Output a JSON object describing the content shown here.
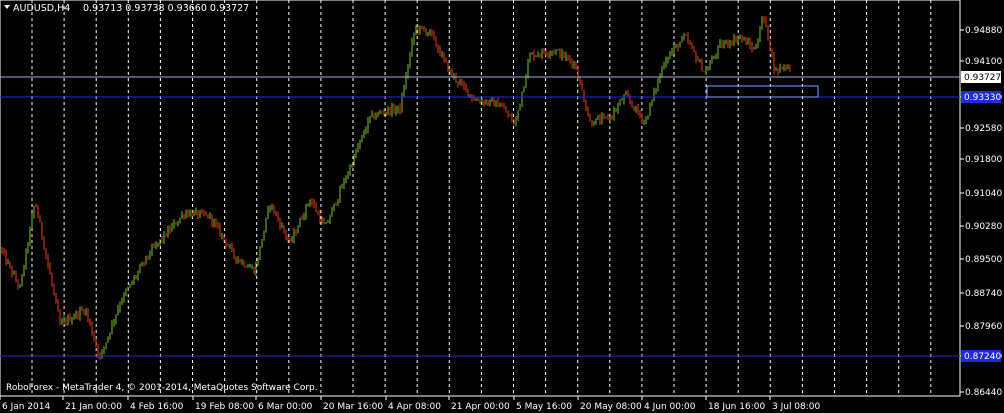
{
  "header": {
    "symbol_tf": "AUDUSD,H4",
    "ohlc": "0.93713 0.93738 0.93660 0.93727"
  },
  "copyright": "RoboForex - MetaTrader 4, © 2001-2014, MetaQuotes Software Corp.",
  "colors": {
    "background": "#000000",
    "up": "#7FBF2A",
    "down": "#E8401C",
    "grid": "#FFFFFF",
    "price_line": "#9FB2D6",
    "hline": "#1F2AE0",
    "label_text": "#FFFFFF"
  },
  "levels": {
    "current_price_label": "0.93727",
    "blue_line_upper": "0.93330",
    "blue_line_lower": "0.87240",
    "rectangle_top": "0.93727"
  },
  "chart_data": {
    "type": "candlestick",
    "title": "",
    "xlabel": "",
    "ylabel": "",
    "ylim": [
      0.8641,
      0.9522
    ],
    "grid": true,
    "y_ticks": [
      "0.94880",
      "0.94100",
      "0.93330",
      "0.92580",
      "0.91800",
      "0.91040",
      "0.90280",
      "0.89500",
      "0.88740",
      "0.87960",
      "0.87240",
      "0.86440"
    ],
    "x_ticks": [
      "6 Jan 2014",
      "21 Jan 00:00",
      "4 Feb 16:00",
      "19 Feb 08:00",
      "6 Mar 00:00",
      "20 Mar 16:00",
      "4 Apr 08:00",
      "21 Apr 00:00",
      "5 May 16:00",
      "20 May 08:00",
      "4 Jun 00:00",
      "18 Jun 16:00",
      "3 Jul 08:00"
    ],
    "path_points": [
      [
        0.0,
        0.897
      ],
      [
        0.02,
        0.888
      ],
      [
        0.035,
        0.9075
      ],
      [
        0.06,
        0.88
      ],
      [
        0.085,
        0.8835
      ],
      [
        0.1,
        0.8725
      ],
      [
        0.12,
        0.885
      ],
      [
        0.15,
        0.896
      ],
      [
        0.185,
        0.905
      ],
      [
        0.21,
        0.904
      ],
      [
        0.235,
        0.895
      ],
      [
        0.255,
        0.892
      ],
      [
        0.27,
        0.907
      ],
      [
        0.29,
        0.898
      ],
      [
        0.31,
        0.908
      ],
      [
        0.325,
        0.9015
      ],
      [
        0.35,
        0.915
      ],
      [
        0.37,
        0.926
      ],
      [
        0.385,
        0.9275
      ],
      [
        0.4,
        0.928
      ],
      [
        0.415,
        0.946
      ],
      [
        0.43,
        0.945
      ],
      [
        0.45,
        0.936
      ],
      [
        0.475,
        0.93
      ],
      [
        0.5,
        0.929
      ],
      [
        0.515,
        0.9245
      ],
      [
        0.53,
        0.94
      ],
      [
        0.555,
        0.941
      ],
      [
        0.575,
        0.938
      ],
      [
        0.59,
        0.925
      ],
      [
        0.61,
        0.926
      ],
      [
        0.625,
        0.931
      ],
      [
        0.645,
        0.925
      ],
      [
        0.665,
        0.939
      ],
      [
        0.685,
        0.944
      ],
      [
        0.705,
        0.936
      ],
      [
        0.72,
        0.942
      ],
      [
        0.74,
        0.944
      ],
      [
        0.755,
        0.941
      ],
      [
        0.763,
        0.9488
      ],
      [
        0.77,
        0.942
      ],
      [
        0.775,
        0.936
      ],
      [
        0.782,
        0.9375
      ],
      [
        0.79,
        0.9373
      ]
    ],
    "notes": ""
  }
}
